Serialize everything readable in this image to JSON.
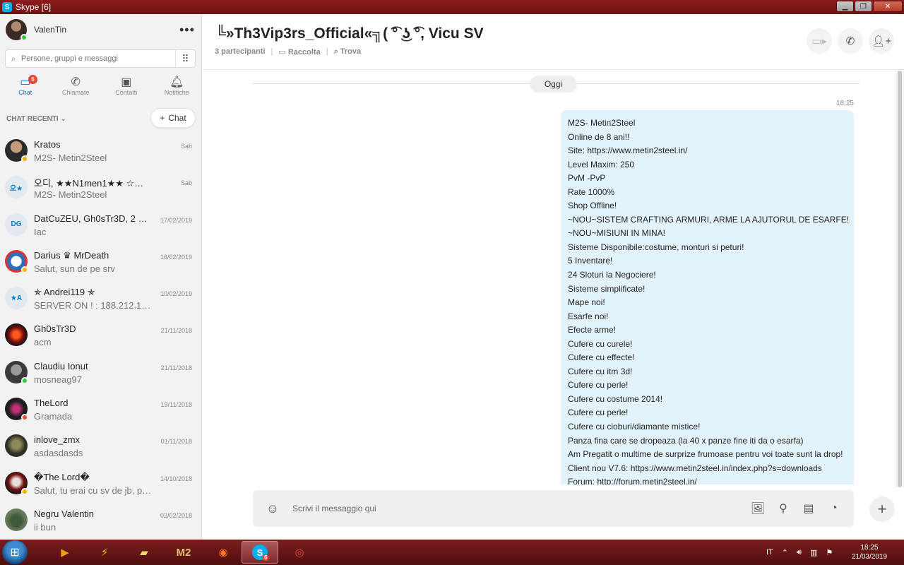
{
  "window": {
    "title": "Skype [6]",
    "icon_label": "S"
  },
  "profile": {
    "name": "ValenTin",
    "status_color": "#2ecc40"
  },
  "search": {
    "placeholder": "Persone, gruppi e messaggi"
  },
  "nav": {
    "tabs": [
      {
        "label": "Chat",
        "icon": "chat-icon",
        "badge": "6"
      },
      {
        "label": "Chiamate",
        "icon": "phone-icon"
      },
      {
        "label": "Contatti",
        "icon": "contacts-icon"
      },
      {
        "label": "Notifiche",
        "icon": "bell-icon"
      }
    ]
  },
  "recent": {
    "header": "CHAT RECENTI",
    "new_chat_label": "Chat"
  },
  "chats": [
    {
      "name": "Kratos",
      "preview": "M2S- Metin2Steel",
      "date": "Sab",
      "initials": "",
      "status": "#f5b400"
    },
    {
      "name": "오디, ★★N1men1★★ ☆☆☆☆☆...",
      "preview": "M2S- Metin2Steel",
      "date": "Sab",
      "initials": "오★",
      "status": ""
    },
    {
      "name": "DatCuZEU, Gh0sTr3D, 2 a...",
      "preview": "Iac",
      "date": "17/02/2019",
      "initials": "DG",
      "status": ""
    },
    {
      "name": "Darius ♛ MrDeath",
      "preview": "Salut, sun de pe srv",
      "date": "16/02/2019",
      "initials": "",
      "status": "#f5b400"
    },
    {
      "name": "✯ Andrei119 ✯",
      "preview": "SERVER ON ! : 188.212.100.…",
      "date": "10/02/2019",
      "initials": "★A",
      "status": ""
    },
    {
      "name": "Gh0sTr3D",
      "preview": "acm",
      "date": "21/11/2018",
      "initials": "",
      "status": ""
    },
    {
      "name": "Claudiu Ionut",
      "preview": "mosneag97",
      "date": "21/11/2018",
      "initials": "",
      "status": "#2ecc40"
    },
    {
      "name": "TheLord",
      "preview": "Gramada",
      "date": "19/11/2018",
      "initials": "",
      "status": "#e8473b"
    },
    {
      "name": "inlove_zmx",
      "preview": "asdasdasds",
      "date": "01/11/2018",
      "initials": "",
      "status": ""
    },
    {
      "name": "�The Lord�",
      "preview": "Salut, tu erai cu sv de jb, pa...",
      "date": "14/10/2018",
      "initials": "",
      "status": "#f5b400"
    },
    {
      "name": "Negru Valentin",
      "preview": "ii bun",
      "date": "02/02/2018",
      "initials": "",
      "status": ""
    }
  ],
  "conversation": {
    "title": "╚»Th3Vip3rs_Official«╗( ͡° ͜ʖ ͡°, Vicu SV",
    "participants": "3 partecipanti",
    "gallery": "Raccolta",
    "find": "Trova",
    "date_separator": "Oggi",
    "message_time": "18:25",
    "message_lines": [
      "M2S- Metin2Steel",
      "Online de 8 ani!!",
      "Site: https://www.metin2steel.in/",
      "Level Maxim: 250",
      "PvM -PvP",
      "Rate 1000%",
      "Shop Offline!",
      "~NOU~SISTEM CRAFTING ARMURI, ARME LA AJUTORUL DE ESARFE!",
      "~NOU~MISIUNI IN MINA!",
      "Sisteme Disponibile:costume, monturi si peturi!",
      "5 Inventare!",
      "24 Sloturi la Negociere!",
      "Sisteme simplificate!",
      "Mape noi!",
      "Esarfe noi!",
      "Efecte arme!",
      "Cufere cu curele!",
      "Cufere cu effecte!",
      "Cufere cu itm 3d!",
      "Cufere cu perle!",
      "Cufere cu costume 2014!",
      "Cufere cu perle!",
      "Cufere cu cioburi/diamante mistice!",
      "Panza fina care se dropeaza (la 40 x panze fine iti da o esarfa)",
      "Am Pregatit o multime de surprize frumoase pentru voi toate sunt la drop!",
      "Client nou V7.6: https://www.metin2steel.in/index.php?s=downloads",
      "Forum: http://forum.metin2steel.in/"
    ],
    "composer_placeholder": "Scrivi il messaggio qui"
  },
  "taskbar": {
    "language": "IT",
    "time": "18:25",
    "date": "21/03/2019",
    "skype_badge": "6"
  },
  "colors": {
    "accent": "#0078d4",
    "bubble": "#e3f3fb",
    "titlebar": "#7a1d1d"
  }
}
